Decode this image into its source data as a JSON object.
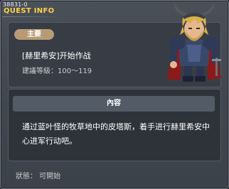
{
  "header": {
    "quest_id": "38831-0",
    "title": "QUEST INFO"
  },
  "summary": {
    "badge": "主要",
    "quest_name": "[赫里希安]开始作战",
    "level_req": "建議等級：100～119"
  },
  "content": {
    "header": "內容",
    "text": "通过蓝叶怪的牧草地中的皮塔斯，着手进行赫里希安中心进军行动吧。"
  },
  "footer": {
    "status": "狀態： 可開始"
  },
  "colors": {
    "title": "#ffd24a",
    "badge": "#b89b74"
  },
  "icons": {
    "avatar": "horned-helmet-knight-portrait"
  }
}
